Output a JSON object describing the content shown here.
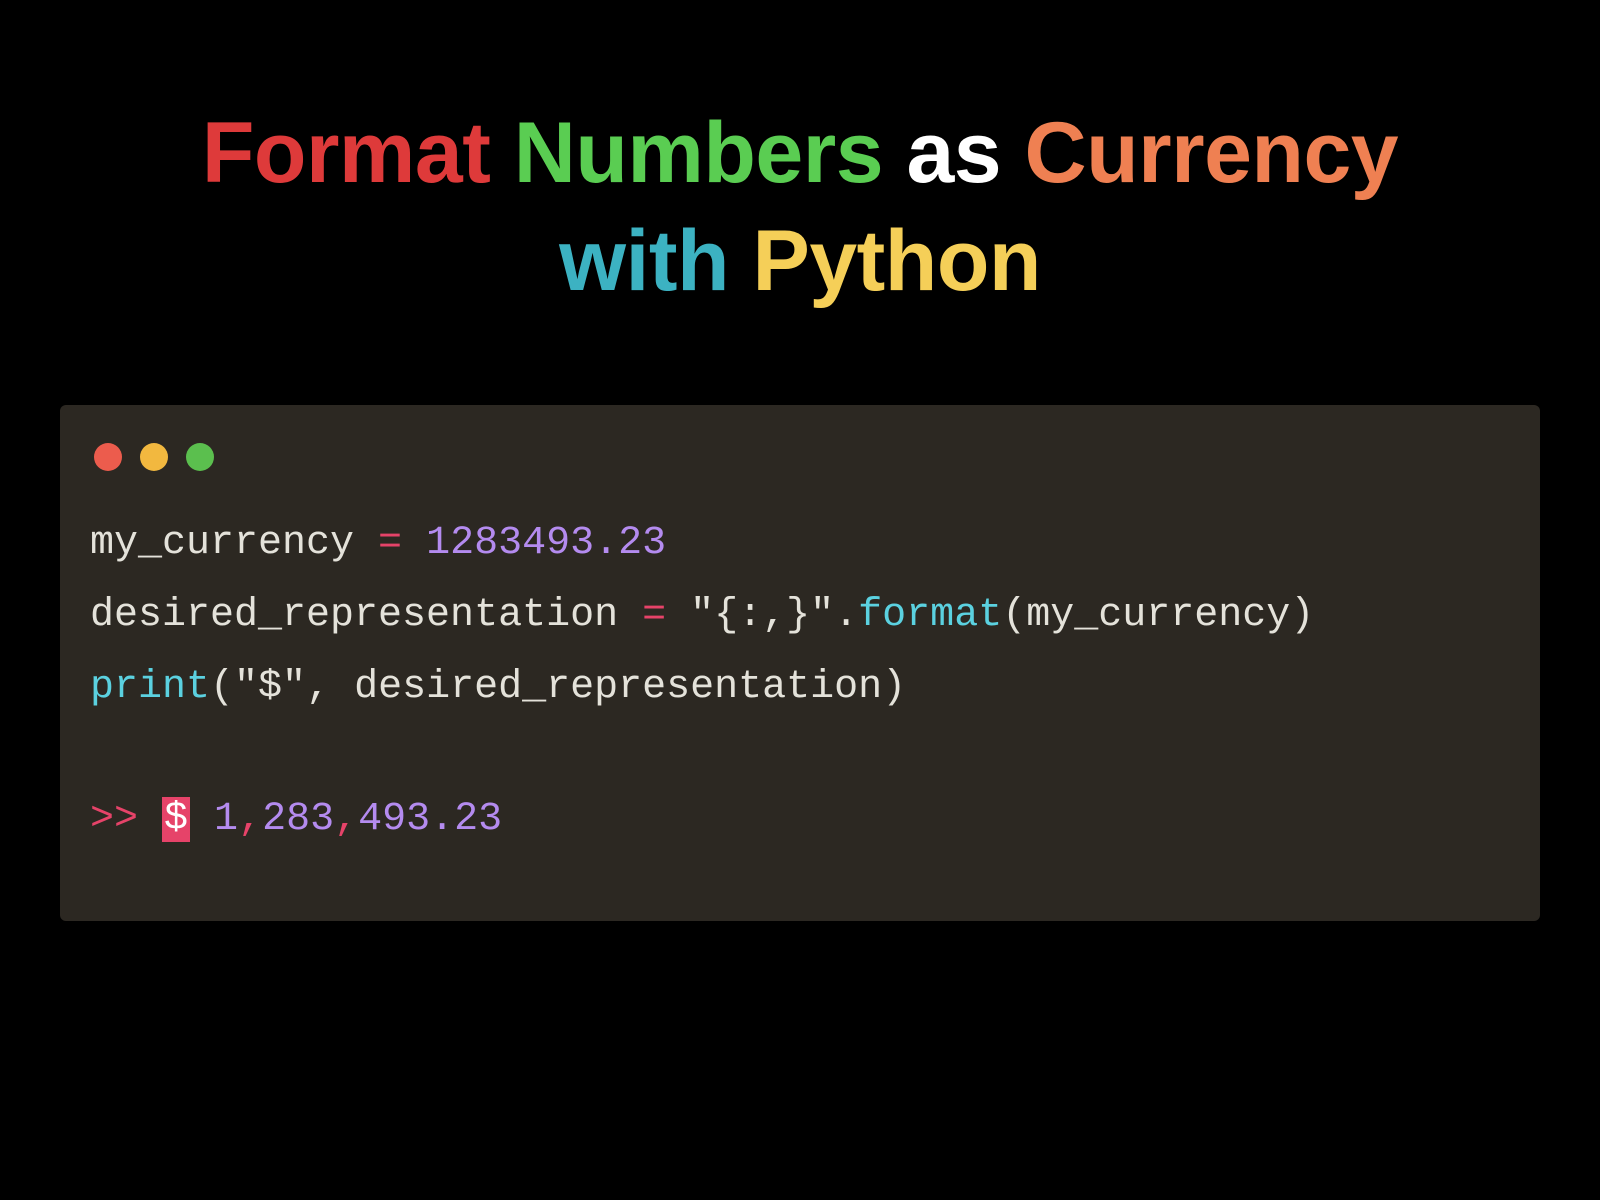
{
  "heading": {
    "w1": "Format",
    "w2": "Numbers",
    "w3": "as",
    "w4": "Currency",
    "w5": "with",
    "w6": "Python"
  },
  "code": {
    "line1": {
      "var": "my_currency ",
      "eq": "=",
      "space": " ",
      "num": "1283493.23"
    },
    "line2": {
      "var": "desired_representation ",
      "eq": "=",
      "space": " ",
      "str": "\"{:,}\"",
      "dot": ".",
      "method": "format",
      "args": "(my_currency)"
    },
    "line3": {
      "func": "print",
      "open": "(",
      "str": "\"$\"",
      "rest": ", desired_representation)"
    }
  },
  "output": {
    "prompt": ">> ",
    "dollar": "$",
    "space": " ",
    "p1": "1",
    "c1": ",",
    "p2": "283",
    "c2": ",",
    "p3": "493.23"
  }
}
